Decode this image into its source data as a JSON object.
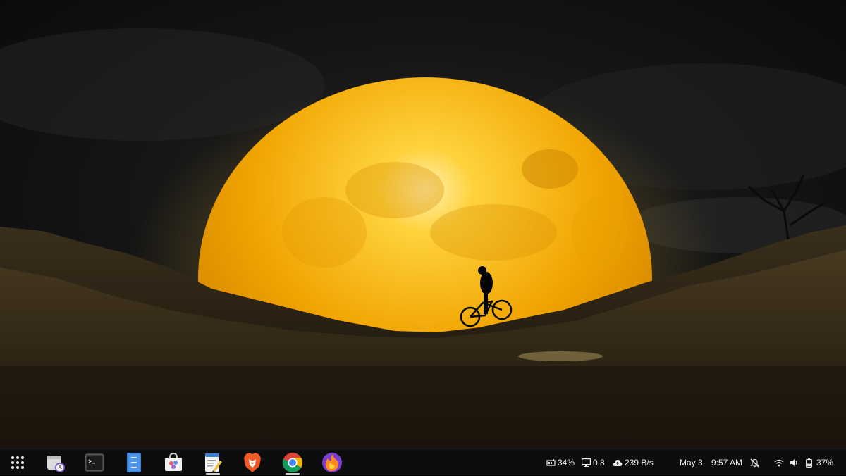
{
  "desktop": {
    "wallpaper": "full moon with cyclist silhouette on hill",
    "colors": {
      "moon": "#f2a500",
      "moon_core": "#ffd24d",
      "sky": "#141414",
      "ground": "#2a2214",
      "taskbar": "#0d0d0d"
    }
  },
  "taskbar": {
    "apps": [
      {
        "name": "App grid",
        "icon": "app-grid-icon"
      },
      {
        "name": "Clocks",
        "icon": "clock-app-icon"
      },
      {
        "name": "Terminal",
        "icon": "terminal-icon"
      },
      {
        "name": "Files",
        "icon": "file-manager-icon"
      },
      {
        "name": "Software Store",
        "icon": "store-icon"
      },
      {
        "name": "Text Editor",
        "icon": "text-editor-icon"
      },
      {
        "name": "Brave",
        "icon": "brave-icon"
      },
      {
        "name": "Chrome",
        "icon": "chrome-icon"
      },
      {
        "name": "Firefox",
        "icon": "firefox-icon"
      }
    ],
    "running_apps": [
      "Text Editor",
      "Chrome"
    ],
    "status": {
      "memory": "34%",
      "load": "0.8",
      "network": "239 B/s",
      "date": "May 3",
      "time": "9:57 AM",
      "battery": "37%"
    },
    "tray_icons": [
      "notifications-muted-icon",
      "wifi-icon",
      "volume-icon",
      "battery-icon"
    ]
  }
}
